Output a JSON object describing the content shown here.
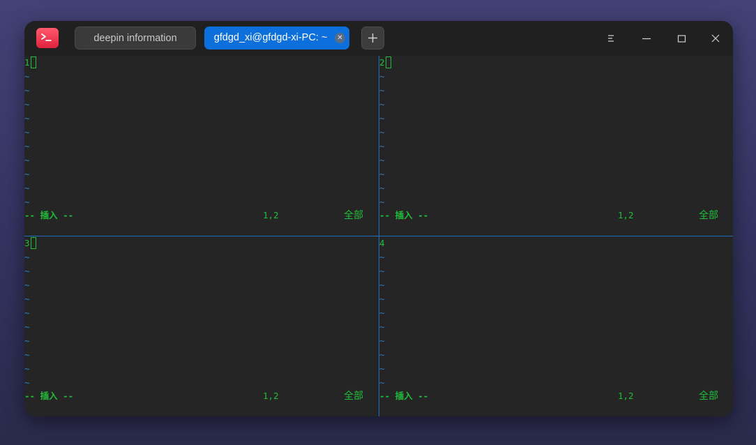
{
  "tabs": [
    {
      "label": "deepin information",
      "active": false
    },
    {
      "label": "gfdgd_xi@gfdgd-xi-PC: ~",
      "active": true
    }
  ],
  "titlebar": {
    "app_icon": "terminal-icon",
    "new_tab_icon": "plus-icon",
    "menu_icon": "hamburger-menu-icon",
    "minimize_icon": "minimize-icon",
    "maximize_icon": "maximize-icon",
    "close_icon": "close-icon"
  },
  "panes": [
    {
      "number": "1",
      "cursor": true,
      "mode": "-- 插入 --",
      "position": "1,2",
      "scroll": "全部"
    },
    {
      "number": "2",
      "cursor": true,
      "mode": "-- 插入 --",
      "position": "1,2",
      "scroll": "全部"
    },
    {
      "number": "3",
      "cursor": true,
      "mode": "-- 插入 --",
      "position": "1,2",
      "scroll": "全部"
    },
    {
      "number": "4",
      "cursor": false,
      "mode": "-- 插入 --",
      "position": "1,2",
      "scroll": "全部"
    }
  ],
  "tilde": "~",
  "colors": {
    "accent": "#0c6fdc",
    "terminal_green": "#1fbf3a",
    "tilde_blue": "#2e7fc4",
    "split_line": "#1e6fc4",
    "background": "#252525"
  }
}
